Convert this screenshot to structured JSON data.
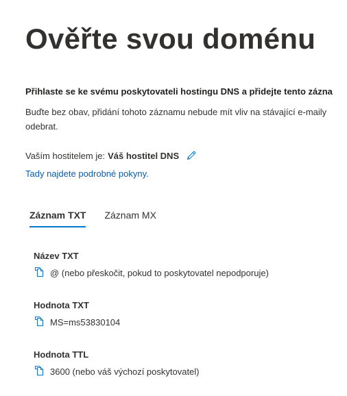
{
  "page": {
    "title": "Ověřte svou doménu"
  },
  "instructions": {
    "bold": "Přihlaste se ke svému poskytovateli hostingu DNS a přidejte tento zázna",
    "body": "Buďte bez obav, přidání tohoto záznamu nebude mít vliv na stávající e-maily odebrat."
  },
  "host": {
    "label": "Vaším hostitelem je:",
    "value": "Váš hostitel DNS",
    "edit_icon": "pencil-icon"
  },
  "details_link": "Tady najdete podrobné pokyny.",
  "tabs": [
    {
      "label": "Záznam TXT",
      "active": true
    },
    {
      "label": "Záznam MX",
      "active": false
    }
  ],
  "records": [
    {
      "label": "Název TXT",
      "value": "@ (nebo přeskočit, pokud to poskytovatel nepodporuje)",
      "icon": "copy-icon"
    },
    {
      "label": "Hodnota TXT",
      "value": "MS=ms53830104",
      "icon": "copy-icon"
    },
    {
      "label": "Hodnota TTL",
      "value": "3600 (nebo váš výchozí poskytovatel)",
      "icon": "copy-icon"
    }
  ],
  "colors": {
    "accent": "#0078d4",
    "link": "#0b5cad",
    "text": "#323130"
  }
}
